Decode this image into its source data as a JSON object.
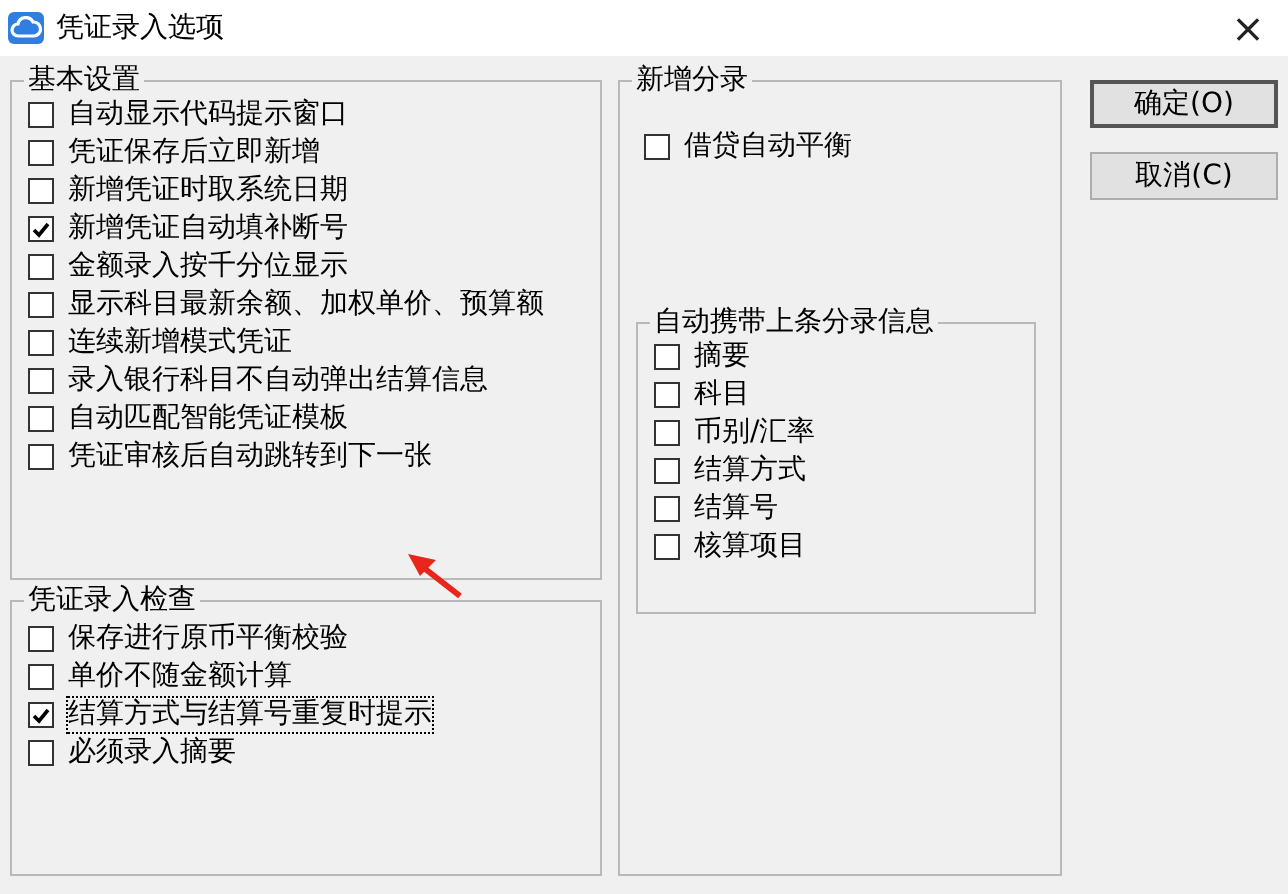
{
  "window": {
    "title": "凭证录入选项",
    "close": "×"
  },
  "basic_settings": {
    "title": "基本设置",
    "items": [
      {
        "label": "自动显示代码提示窗口",
        "checked": false
      },
      {
        "label": "凭证保存后立即新增",
        "checked": false
      },
      {
        "label": "新增凭证时取系统日期",
        "checked": false
      },
      {
        "label": "新增凭证自动填补断号",
        "checked": true
      },
      {
        "label": "金额录入按千分位显示",
        "checked": false
      },
      {
        "label": "显示科目最新余额、加权单价、预算额",
        "checked": false
      },
      {
        "label": "连续新增模式凭证",
        "checked": false
      },
      {
        "label": "录入银行科目不自动弹出结算信息",
        "checked": false
      },
      {
        "label": "自动匹配智能凭证模板",
        "checked": false
      },
      {
        "label": "凭证审核后自动跳转到下一张",
        "checked": false
      }
    ]
  },
  "entry_check": {
    "title": "凭证录入检查",
    "items": [
      {
        "label": "保存进行原币平衡校验",
        "checked": false,
        "focused": false
      },
      {
        "label": "单价不随金额计算",
        "checked": false,
        "focused": false
      },
      {
        "label": "结算方式与结算号重复时提示",
        "checked": true,
        "focused": true
      },
      {
        "label": "必须录入摘要",
        "checked": false,
        "focused": false
      }
    ]
  },
  "new_entry": {
    "title": "新增分录",
    "items": [
      {
        "label": "借贷自动平衡",
        "checked": false
      }
    ],
    "carry_over": {
      "title": "自动携带上条分录信息",
      "items": [
        {
          "label": "摘要",
          "checked": false
        },
        {
          "label": "科目",
          "checked": false
        },
        {
          "label": "币别/汇率",
          "checked": false
        },
        {
          "label": "结算方式",
          "checked": false
        },
        {
          "label": "结算号",
          "checked": false
        },
        {
          "label": "核算项目",
          "checked": false
        }
      ]
    }
  },
  "buttons": [
    {
      "label": "确定(O)",
      "default": true
    },
    {
      "label": "取消(C)",
      "default": false
    }
  ]
}
